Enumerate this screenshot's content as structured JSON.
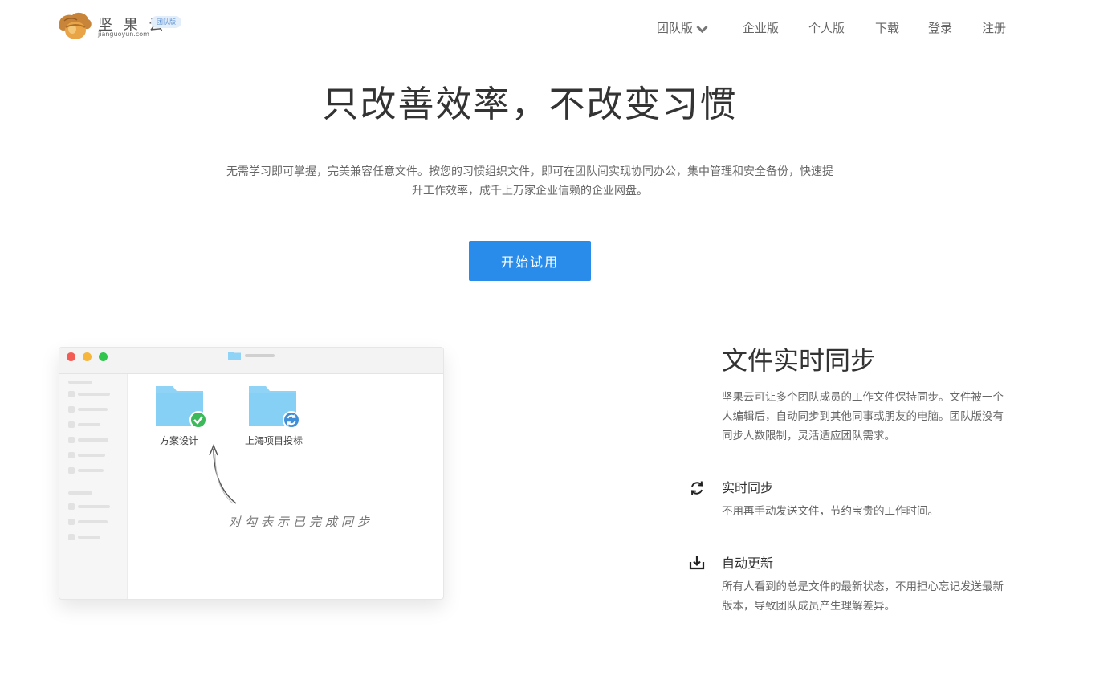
{
  "header": {
    "logo_cn": "坚 果 云",
    "logo_en": "jianguoyun.com",
    "logo_badge": "团队版",
    "nav": [
      {
        "label": "团队版"
      },
      {
        "label": "企业版"
      },
      {
        "label": "个人版"
      },
      {
        "label": "下载"
      },
      {
        "label": "登录"
      },
      {
        "label": "注册"
      }
    ]
  },
  "hero": {
    "title": "只改善效率，不改变习惯",
    "description": "无需学习即可掌握，完美兼容任意文件。按您的习惯组织文件，即可在团队间实现协同办公，集中管理和安全备份，快速提升工作效率，成千上万家企业信赖的企业网盘。",
    "cta_label": "开始试用"
  },
  "mockup": {
    "folders": [
      {
        "name": "方案设计",
        "status": "synced-check-icon"
      },
      {
        "name": "上海项目投标",
        "status": "syncing-icon"
      }
    ],
    "annotation": "对勾表示已完成同步"
  },
  "feature": {
    "title": "文件实时同步",
    "description": "坚果云可让多个团队成员的工作文件保持同步。文件被一个人编辑后，自动同步到其他同事或朋友的电脑。团队版没有同步人数限制，灵活适应团队需求。",
    "items": [
      {
        "icon": "sync-icon",
        "title": "实时同步",
        "desc": "不用再手动发送文件，节约宝贵的工作时间。"
      },
      {
        "icon": "download-icon",
        "title": "自动更新",
        "desc": "所有人看到的总是文件的最新状态，不用担心忘记发送最新版本，导致团队成员产生理解差异。"
      }
    ]
  },
  "colors": {
    "accent": "#2a8cea",
    "folder": "#8fd3f7",
    "check": "#3cb95a",
    "sync": "#3f8fd8"
  }
}
